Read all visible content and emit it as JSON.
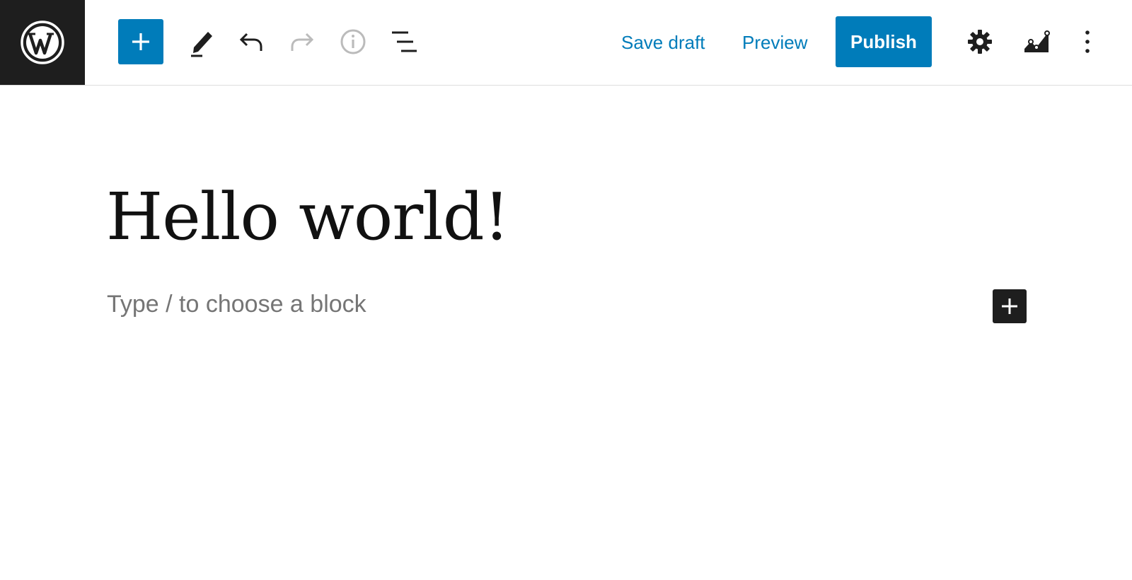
{
  "toolbar": {
    "logo_icon": "wordpress-logo-icon",
    "add_block_icon": "plus-icon",
    "tools": [
      {
        "name": "edit-icon"
      },
      {
        "name": "undo-icon"
      },
      {
        "name": "redo-icon",
        "disabled": true
      },
      {
        "name": "info-icon",
        "disabled": true
      },
      {
        "name": "list-view-icon"
      }
    ],
    "save_draft_label": "Save draft",
    "preview_label": "Preview",
    "publish_label": "Publish",
    "settings_icon": "gear-icon",
    "stats_icon": "stats-chart-icon",
    "more_icon": "vertical-ellipsis-icon"
  },
  "editor": {
    "post_title": "Hello world!",
    "block_placeholder": "Type / to choose a block",
    "block_inserter_icon": "plus-icon"
  },
  "colors": {
    "accent": "#007cba",
    "dark": "#1e1e1e",
    "placeholder": "#757575",
    "disabled": "#bbbbbb"
  }
}
